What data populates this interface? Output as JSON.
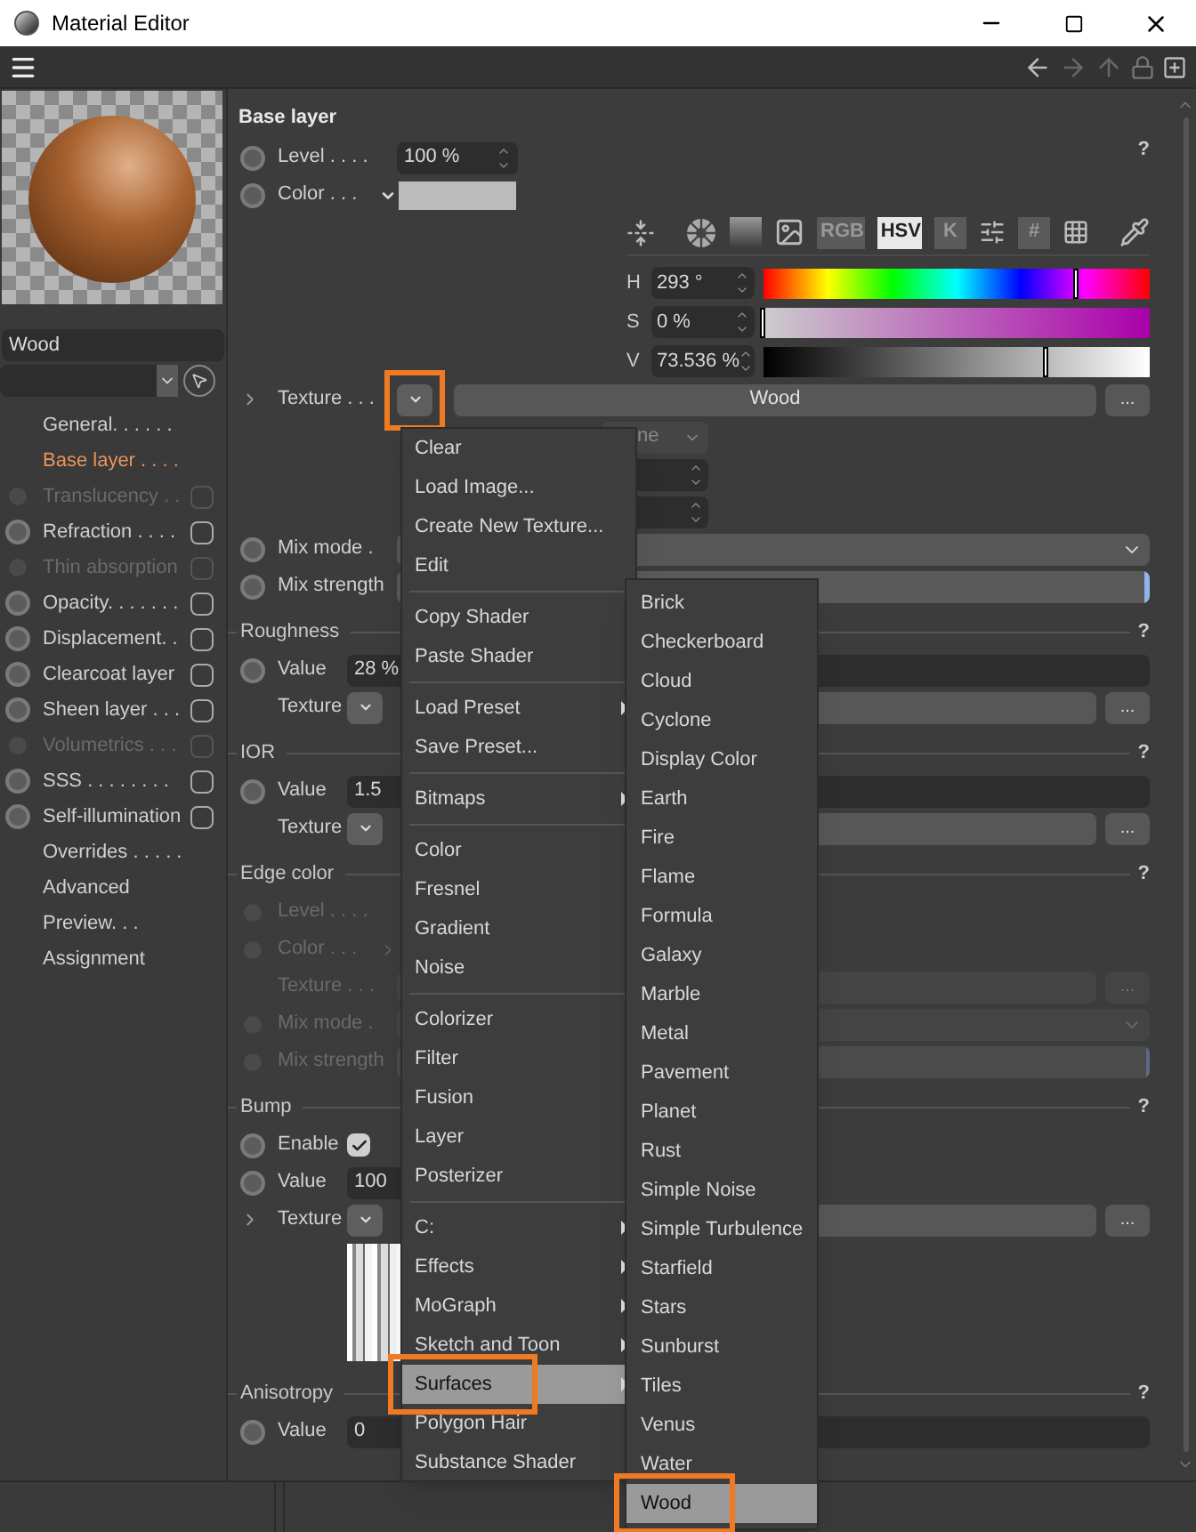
{
  "window": {
    "title": "Material Editor"
  },
  "preview": {
    "name": "Wood"
  },
  "sidebar": {
    "items": [
      {
        "label": "General. . . . . .",
        "kind": "page",
        "selected": false
      },
      {
        "label": "Base layer . . . .",
        "kind": "page",
        "selected": true
      },
      {
        "label": "Translucency . .",
        "kind": "channel",
        "enabled": false,
        "checked": false,
        "selected": false
      },
      {
        "label": "Refraction . . . .",
        "kind": "channel",
        "enabled": true,
        "checked": false,
        "selected": false
      },
      {
        "label": "Thin absorption",
        "kind": "channel",
        "enabled": false,
        "checked": false,
        "selected": false
      },
      {
        "label": "Opacity. . . . . . .",
        "kind": "channel",
        "enabled": true,
        "checked": false,
        "selected": false
      },
      {
        "label": "Displacement. .",
        "kind": "channel",
        "enabled": true,
        "checked": false,
        "selected": false
      },
      {
        "label": "Clearcoat layer",
        "kind": "channel",
        "enabled": true,
        "checked": false,
        "selected": false
      },
      {
        "label": "Sheen layer . . .",
        "kind": "channel",
        "enabled": true,
        "checked": false,
        "selected": false
      },
      {
        "label": "Volumetrics . . .",
        "kind": "channel",
        "enabled": false,
        "checked": false,
        "selected": false
      },
      {
        "label": "SSS . . . . . . . .",
        "kind": "channel",
        "enabled": true,
        "checked": false,
        "selected": false
      },
      {
        "label": "Self-illumination",
        "kind": "channel",
        "enabled": true,
        "checked": false,
        "selected": false
      },
      {
        "label": "Overrides . . . . .",
        "kind": "page",
        "selected": false
      },
      {
        "label": "Advanced",
        "kind": "page",
        "selected": false
      },
      {
        "label": "Preview. . .",
        "kind": "page",
        "selected": false
      },
      {
        "label": "Assignment",
        "kind": "page",
        "selected": false
      }
    ]
  },
  "sections": [
    {
      "title": "Base layer",
      "kind": "layer",
      "help": "?",
      "rows": [
        {
          "kind": "spinner",
          "label": "Level . . . .",
          "value": "100 %",
          "enabled": true
        },
        {
          "kind": "color",
          "label": "Color . . .",
          "enabled": true,
          "expanded": true,
          "picker": {
            "tools": [
              {
                "kind": "icon",
                "selected": false
              },
              {
                "kind": "icon",
                "selected": false
              },
              {
                "kind": "icon",
                "selected": false
              },
              {
                "kind": "icon",
                "selected": false
              },
              {
                "kind": "text",
                "label": "RGB",
                "selected": false
              },
              {
                "kind": "text",
                "label": "HSV",
                "selected": true
              },
              {
                "kind": "text",
                "label": "K",
                "selected": false
              },
              {
                "kind": "icon",
                "selected": false
              },
              {
                "kind": "text",
                "label": "#",
                "selected": false
              },
              {
                "kind": "icon",
                "selected": false
              },
              {
                "kind": "icon",
                "selected": false
              }
            ],
            "channels": [
              {
                "name": "H",
                "value": "293 °",
                "level": 0.81
              },
              {
                "name": "S",
                "value": "0 %",
                "level": 0
              },
              {
                "name": "V",
                "value": "73.536 %",
                "level": 0.735
              }
            ]
          }
        },
        {
          "kind": "texture",
          "label": "Texture . . .",
          "enabled": true,
          "expanded": false,
          "value": "Wood",
          "button": "...",
          "highlighted": true
        },
        {
          "kind": "sub_select",
          "value": "ne"
        },
        {
          "kind": "sub_spinner"
        },
        {
          "kind": "sub_spinner"
        },
        {
          "kind": "dropdown",
          "label": "Mix mode .",
          "enabled": true
        },
        {
          "kind": "slider",
          "label": "Mix strength",
          "enabled": true,
          "level": 1
        }
      ]
    },
    {
      "title": "Roughness",
      "kind": "property",
      "help": "?",
      "rows": [
        {
          "kind": "value_slider",
          "label": "Value",
          "value": "28 %",
          "enabled": true
        },
        {
          "kind": "texture",
          "label": "Texture",
          "enabled": true,
          "button": "...",
          "highlighted": false
        }
      ]
    },
    {
      "title": "IOR",
      "kind": "property",
      "help": "?",
      "rows": [
        {
          "kind": "value_slider",
          "label": "Value",
          "value": "1.5",
          "enabled": true
        },
        {
          "kind": "texture",
          "label": "Texture",
          "enabled": true,
          "button": "...",
          "highlighted": false
        }
      ]
    },
    {
      "title": "Edge color",
      "kind": "layer",
      "help": "?",
      "rows": [
        {
          "kind": "spinner",
          "label": "Level . . . .",
          "enabled": false
        },
        {
          "kind": "color",
          "label": "Color . . .",
          "enabled": false,
          "expanded": false
        },
        {
          "kind": "texture",
          "label": "Texture . . .",
          "enabled": false,
          "button": "...",
          "highlighted": false
        },
        {
          "kind": "dropdown",
          "label": "Mix mode .",
          "enabled": false
        },
        {
          "kind": "slider",
          "label": "Mix strength",
          "enabled": false,
          "level": 1
        }
      ]
    },
    {
      "title": "Bump",
      "kind": "property",
      "help": "?",
      "rows": [
        {
          "kind": "checkbox",
          "label": "Enable",
          "enabled": true,
          "checked": true
        },
        {
          "kind": "spinner",
          "label": "Value",
          "value": "100",
          "enabled": true
        },
        {
          "kind": "texture",
          "label": "Texture",
          "enabled": true,
          "expanded": false,
          "button": "...",
          "highlighted": false
        },
        {
          "kind": "thumbnail"
        }
      ]
    },
    {
      "title": "Anisotropy",
      "kind": "property",
      "help": "?",
      "rows": [
        {
          "kind": "value_slider",
          "label": "Value",
          "value": "0",
          "enabled": true
        }
      ]
    }
  ],
  "menu": {
    "items": [
      {
        "kind": "item",
        "label": "Clear",
        "submenu": false,
        "selected": false,
        "highlighted": false
      },
      {
        "kind": "item",
        "label": "Load Image...",
        "submenu": false,
        "selected": false,
        "highlighted": false
      },
      {
        "kind": "item",
        "label": "Create New Texture...",
        "submenu": false,
        "selected": false,
        "highlighted": false
      },
      {
        "kind": "item",
        "label": "Edit",
        "submenu": false,
        "selected": false,
        "highlighted": false
      },
      {
        "kind": "separator"
      },
      {
        "kind": "item",
        "label": "Copy Shader",
        "submenu": false,
        "selected": false,
        "highlighted": false
      },
      {
        "kind": "item",
        "label": "Paste Shader",
        "submenu": false,
        "selected": false,
        "highlighted": false
      },
      {
        "kind": "separator"
      },
      {
        "kind": "item",
        "label": "Load Preset",
        "submenu": true,
        "selected": false,
        "highlighted": false
      },
      {
        "kind": "item",
        "label": "Save Preset...",
        "submenu": false,
        "selected": false,
        "highlighted": false
      },
      {
        "kind": "separator"
      },
      {
        "kind": "item",
        "label": "Bitmaps",
        "submenu": true,
        "selected": false,
        "highlighted": false
      },
      {
        "kind": "separator"
      },
      {
        "kind": "item",
        "label": "Color",
        "submenu": false,
        "selected": false,
        "highlighted": false
      },
      {
        "kind": "item",
        "label": "Fresnel",
        "submenu": false,
        "selected": false,
        "highlighted": false
      },
      {
        "kind": "item",
        "label": "Gradient",
        "submenu": false,
        "selected": false,
        "highlighted": false
      },
      {
        "kind": "item",
        "label": "Noise",
        "submenu": false,
        "selected": false,
        "highlighted": false
      },
      {
        "kind": "separator"
      },
      {
        "kind": "item",
        "label": "Colorizer",
        "submenu": false,
        "selected": false,
        "highlighted": false
      },
      {
        "kind": "item",
        "label": "Filter",
        "submenu": false,
        "selected": false,
        "highlighted": false
      },
      {
        "kind": "item",
        "label": "Fusion",
        "submenu": false,
        "selected": false,
        "highlighted": false
      },
      {
        "kind": "item",
        "label": "Layer",
        "submenu": false,
        "selected": false,
        "highlighted": false
      },
      {
        "kind": "item",
        "label": "Posterizer",
        "submenu": false,
        "selected": false,
        "highlighted": false
      },
      {
        "kind": "separator"
      },
      {
        "kind": "item",
        "label": "C:",
        "submenu": true,
        "selected": false,
        "highlighted": false
      },
      {
        "kind": "item",
        "label": "Effects",
        "submenu": true,
        "selected": false,
        "highlighted": false
      },
      {
        "kind": "item",
        "label": "MoGraph",
        "submenu": true,
        "selected": false,
        "highlighted": false
      },
      {
        "kind": "item",
        "label": "Sketch and Toon",
        "submenu": true,
        "selected": false,
        "highlighted": false
      },
      {
        "kind": "item",
        "label": "Surfaces",
        "submenu": true,
        "selected": true,
        "highlighted": true
      },
      {
        "kind": "item",
        "label": "Polygon Hair",
        "submenu": false,
        "selected": false,
        "highlighted": false
      },
      {
        "kind": "item",
        "label": "Substance Shader",
        "submenu": false,
        "selected": false,
        "highlighted": false
      }
    ]
  },
  "submenu": {
    "items": [
      {
        "label": "Brick",
        "selected": false,
        "highlighted": false
      },
      {
        "label": "Checkerboard",
        "selected": false,
        "highlighted": false
      },
      {
        "label": "Cloud",
        "selected": false,
        "highlighted": false
      },
      {
        "label": "Cyclone",
        "selected": false,
        "highlighted": false
      },
      {
        "label": "Display Color",
        "selected": false,
        "highlighted": false
      },
      {
        "label": "Earth",
        "selected": false,
        "highlighted": false
      },
      {
        "label": "Fire",
        "selected": false,
        "highlighted": false
      },
      {
        "label": "Flame",
        "selected": false,
        "highlighted": false
      },
      {
        "label": "Formula",
        "selected": false,
        "highlighted": false
      },
      {
        "label": "Galaxy",
        "selected": false,
        "highlighted": false
      },
      {
        "label": "Marble",
        "selected": false,
        "highlighted": false
      },
      {
        "label": "Metal",
        "selected": false,
        "highlighted": false
      },
      {
        "label": "Pavement",
        "selected": false,
        "highlighted": false
      },
      {
        "label": "Planet",
        "selected": false,
        "highlighted": false
      },
      {
        "label": "Rust",
        "selected": false,
        "highlighted": false
      },
      {
        "label": "Simple Noise",
        "selected": false,
        "highlighted": false
      },
      {
        "label": "Simple Turbulence",
        "selected": false,
        "highlighted": false
      },
      {
        "label": "Starfield",
        "selected": false,
        "highlighted": false
      },
      {
        "label": "Stars",
        "selected": false,
        "highlighted": false
      },
      {
        "label": "Sunburst",
        "selected": false,
        "highlighted": false
      },
      {
        "label": "Tiles",
        "selected": false,
        "highlighted": false
      },
      {
        "label": "Venus",
        "selected": false,
        "highlighted": false
      },
      {
        "label": "Water",
        "selected": false,
        "highlighted": false
      },
      {
        "label": "Wood",
        "selected": true,
        "highlighted": true
      }
    ]
  }
}
